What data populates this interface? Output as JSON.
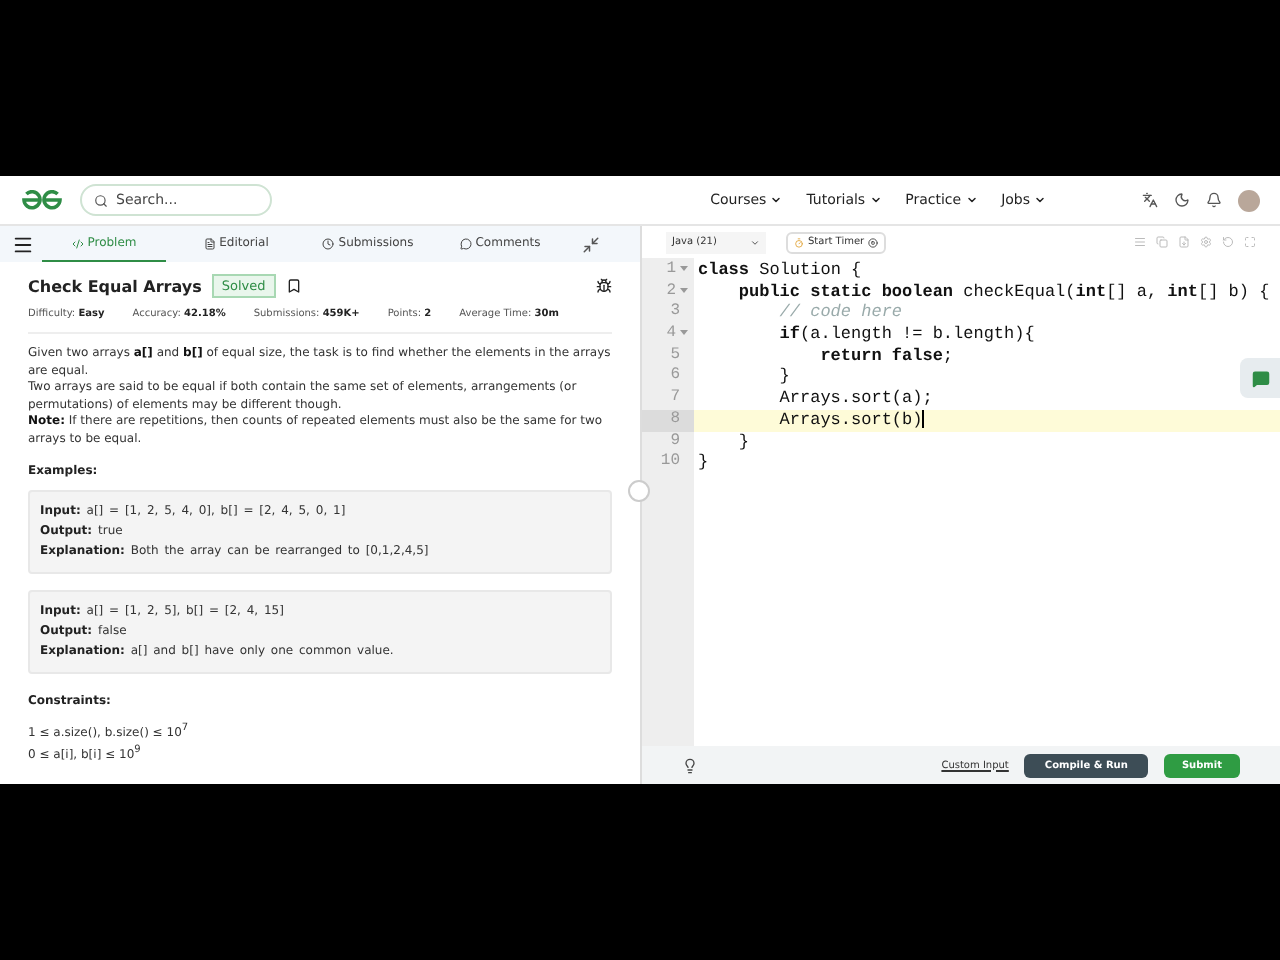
{
  "header": {
    "search": {
      "placeholder": "Search..."
    },
    "nav": [
      "Courses",
      "Tutorials",
      "Practice",
      "Jobs"
    ]
  },
  "problem_tabs": [
    {
      "label": "Problem",
      "selected": true
    },
    {
      "label": "Editorial",
      "selected": false
    },
    {
      "label": "Submissions",
      "selected": false
    },
    {
      "label": "Comments",
      "selected": false
    }
  ],
  "problem": {
    "title": "Check Equal Arrays",
    "status": "Solved",
    "bookmarked": false,
    "stats": [
      {
        "label": "Difficulty:",
        "value": "Easy"
      },
      {
        "label": "Accuracy:",
        "value": "42.18%"
      },
      {
        "label": "Submissions:",
        "value": "459K+"
      },
      {
        "label": "Points:",
        "value": "2"
      },
      {
        "label": "Average Time:",
        "value": "30m"
      }
    ],
    "description": [
      "Given two arrays **a[]** and **b[]** of equal size, the task is to find whether the elements in the arrays are equal.",
      "Two arrays are said to be equal if both contain the same set of elements, arrangements (or permutations) of elements may be different though.",
      "**Note:** If there are repetitions, then counts of repeated elements must also be the same for two arrays to be equal."
    ],
    "examples_heading": "Examples:",
    "examples": [
      [
        {
          "label": "Input:",
          "text": "a[] = [1, 2, 5, 4, 0], b[] = [2, 4, 5, 0, 1]"
        },
        {
          "label": "Output:",
          "text": "true"
        },
        {
          "label": "Explanation:",
          "text": "Both the array can be rearranged to [0,1,2,4,5]"
        }
      ],
      [
        {
          "label": "Input:",
          "text": "a[] = [1, 2, 5], b[] = [2, 4, 15]"
        },
        {
          "label": "Output:",
          "text": "false"
        },
        {
          "label": "Explanation:",
          "text": "a[] and b[] have only one common value."
        }
      ]
    ],
    "constraints_heading": "Constraints:",
    "constraints": [
      "1 ≤ a.size(), b.size() ≤ 10$^{7}$",
      "0 ≤ a[i], b[i] ≤ 10$^{9}$"
    ]
  },
  "editor": {
    "language": "Java (21)",
    "timer_button": "Start Timer",
    "lines": [
      {
        "number": "1",
        "foldable": true,
        "highlighted": false,
        "tokens": [
          {
            "kind": "keyword",
            "text": "class"
          },
          {
            "kind": "plain",
            "text": " Solution {"
          }
        ]
      },
      {
        "number": "2",
        "foldable": true,
        "highlighted": false,
        "tokens": [
          {
            "kind": "keyword",
            "text": "    public static boolean"
          },
          {
            "kind": "plain",
            "text": " checkEqual("
          },
          {
            "kind": "keyword",
            "text": "int"
          },
          {
            "kind": "plain",
            "text": "[] a, "
          },
          {
            "kind": "keyword",
            "text": "int"
          },
          {
            "kind": "plain",
            "text": "[] b) {"
          }
        ]
      },
      {
        "number": "3",
        "foldable": false,
        "highlighted": false,
        "tokens": [
          {
            "kind": "comment",
            "text": "        // code here"
          }
        ]
      },
      {
        "number": "4",
        "foldable": true,
        "highlighted": false,
        "tokens": [
          {
            "kind": "keyword",
            "text": "        if"
          },
          {
            "kind": "plain",
            "text": "(a.length != b.length){"
          }
        ]
      },
      {
        "number": "5",
        "foldable": false,
        "highlighted": false,
        "tokens": [
          {
            "kind": "keyword",
            "text": "            return false"
          },
          {
            "kind": "plain",
            "text": ";"
          }
        ]
      },
      {
        "number": "6",
        "foldable": false,
        "highlighted": false,
        "tokens": [
          {
            "kind": "plain",
            "text": "        }"
          }
        ]
      },
      {
        "number": "7",
        "foldable": false,
        "highlighted": false,
        "tokens": [
          {
            "kind": "plain",
            "text": "        Arrays.sort(a);"
          }
        ]
      },
      {
        "number": "8",
        "foldable": false,
        "highlighted": true,
        "tokens": [
          {
            "kind": "plain",
            "text": "        Arrays.sort(b)"
          }
        ]
      },
      {
        "number": "9",
        "foldable": false,
        "highlighted": false,
        "tokens": [
          {
            "kind": "plain",
            "text": "    }"
          }
        ]
      },
      {
        "number": "10",
        "foldable": false,
        "highlighted": false,
        "tokens": [
          {
            "kind": "plain",
            "text": "}"
          }
        ]
      }
    ]
  },
  "footer": {
    "custom_input": "Custom Input",
    "compile": "Compile & Run",
    "submit": "Submit"
  }
}
